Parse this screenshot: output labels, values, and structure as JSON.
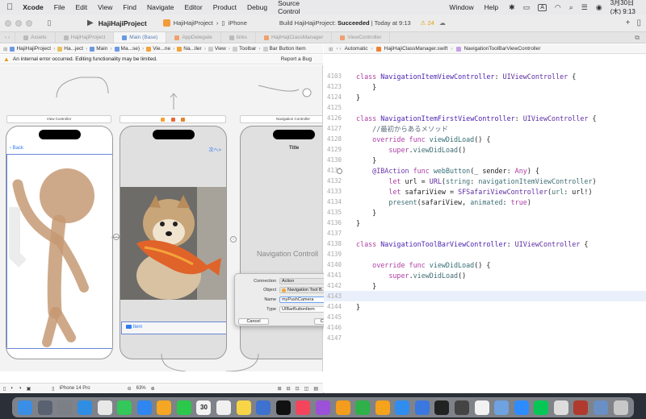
{
  "menubar": {
    "apple": "",
    "app": "Xcode",
    "items": [
      "File",
      "Edit",
      "View",
      "Find",
      "Navigate",
      "Editor",
      "Product",
      "Debug",
      "Source Control"
    ],
    "right_items": [
      "Window",
      "Help"
    ],
    "input_mode": "A",
    "datetime": "3月30日(木) 9:13"
  },
  "toolbar": {
    "project_title": "HajiHajiProject",
    "scheme": "HajiHajiProject",
    "device": "iPhone",
    "status_prefix": "Build HajiHajiProject:",
    "status_result": "Succeeded",
    "status_time": "Today at 9:13",
    "warning_count": "24"
  },
  "tabs": [
    {
      "label": "Assets"
    },
    {
      "label": "HajiHajiProject"
    },
    {
      "label": "Main (Base)"
    },
    {
      "label": "AppDelegate"
    },
    {
      "label": "links"
    },
    {
      "label": "HajiHajiClassManager"
    },
    {
      "label": "ViewController"
    }
  ],
  "jump_left": [
    "HajiHajiProject",
    "Ha...ject",
    "Main",
    "Ma...se)",
    "Vie...ne",
    "Na...ller",
    "View",
    "Toolbar",
    "Bar Button Item"
  ],
  "jump_right": [
    "Automatic",
    "HajiHajiClassManager.swift",
    "NavigationToolBarViewController"
  ],
  "banner": {
    "message": "An internal error occurred. Editing functionality may be limited.",
    "report": "Report a Bug"
  },
  "storyboard": {
    "scene1_title": "View Controller",
    "scene3_title": "Navigation Controller",
    "back_label": "Back",
    "next_label": "次へ>",
    "title_label": "Title",
    "item_label": "Item",
    "nav_controller_label": "Navigation Controll"
  },
  "popup": {
    "connection_label": "Connection",
    "connection_value": "Action",
    "object_label": "Object",
    "object_value": "Navigation Tool B...",
    "name_label": "Name",
    "name_value": "myPushCamera",
    "type_label": "Type",
    "type_value": "UIBarButtonItem",
    "cancel": "Cancel",
    "connect": "Connect"
  },
  "canvas_bottom": {
    "device": "iPhone 14 Pro",
    "zoom": "63%"
  },
  "code": {
    "lines": [
      {
        "n": "4103",
        "tokens": [
          [
            "k",
            "class "
          ],
          [
            "tb",
            "NavigationItemViewController"
          ],
          [
            "p",
            ": "
          ],
          [
            "t",
            "UIViewController"
          ],
          [
            "p",
            " {"
          ]
        ]
      },
      {
        "n": "4123",
        "tokens": [
          [
            "p",
            "    }"
          ]
        ]
      },
      {
        "n": "4124",
        "tokens": [
          [
            "p",
            "}"
          ]
        ]
      },
      {
        "n": "4125",
        "tokens": []
      },
      {
        "n": "4126",
        "tokens": [
          [
            "k",
            "class "
          ],
          [
            "tb",
            "NavigationItemFirstViewController"
          ],
          [
            "p",
            ": "
          ],
          [
            "t",
            "UIViewController"
          ],
          [
            "p",
            " {"
          ]
        ]
      },
      {
        "n": "4127",
        "tokens": [
          [
            "c",
            "    //最初からあるメソッド"
          ]
        ]
      },
      {
        "n": "4128",
        "tokens": [
          [
            "k",
            "    override func "
          ],
          [
            "f",
            "viewDidLoad"
          ],
          [
            "p",
            "() {"
          ]
        ]
      },
      {
        "n": "4129",
        "tokens": [
          [
            "k",
            "        super"
          ],
          [
            "p",
            "."
          ],
          [
            "m",
            "viewDidLoad"
          ],
          [
            "p",
            "()"
          ]
        ]
      },
      {
        "n": "4130",
        "tokens": [
          [
            "p",
            "    }"
          ]
        ]
      },
      {
        "n": "4131",
        "tokens": [
          [
            "a",
            "    @IBAction "
          ],
          [
            "k",
            "func "
          ],
          [
            "f",
            "webButton"
          ],
          [
            "p",
            "(_ sender: "
          ],
          [
            "k",
            "Any"
          ],
          [
            "p",
            ") {"
          ]
        ],
        "bp": true
      },
      {
        "n": "4132",
        "tokens": [
          [
            "k",
            "        let "
          ],
          [
            "p",
            "url = "
          ],
          [
            "t",
            "URL"
          ],
          [
            "p",
            "("
          ],
          [
            "m",
            "string"
          ],
          [
            "p",
            ": "
          ],
          [
            "m",
            "navigationItemViewController"
          ],
          [
            "p",
            ")"
          ]
        ]
      },
      {
        "n": "4133",
        "tokens": [
          [
            "k",
            "        let "
          ],
          [
            "p",
            "safariView = "
          ],
          [
            "t",
            "SFSafariViewController"
          ],
          [
            "p",
            "("
          ],
          [
            "m",
            "url"
          ],
          [
            "p",
            ": url!)"
          ]
        ]
      },
      {
        "n": "4134",
        "tokens": [
          [
            "m",
            "        present"
          ],
          [
            "p",
            "(safariView, "
          ],
          [
            "m",
            "animated"
          ],
          [
            "p",
            ": "
          ],
          [
            "k",
            "true"
          ],
          [
            "p",
            ")"
          ]
        ]
      },
      {
        "n": "4135",
        "tokens": [
          [
            "p",
            "    }"
          ]
        ]
      },
      {
        "n": "4136",
        "tokens": [
          [
            "p",
            "}"
          ]
        ]
      },
      {
        "n": "4137",
        "tokens": []
      },
      {
        "n": "4138",
        "tokens": [
          [
            "k",
            "class "
          ],
          [
            "tb",
            "NavigationToolBarViewController"
          ],
          [
            "p",
            ": "
          ],
          [
            "t",
            "UIViewController"
          ],
          [
            "p",
            " {"
          ]
        ]
      },
      {
        "n": "4139",
        "tokens": []
      },
      {
        "n": "4140",
        "tokens": [
          [
            "k",
            "    override func "
          ],
          [
            "f",
            "viewDidLoad"
          ],
          [
            "p",
            "() {"
          ]
        ]
      },
      {
        "n": "4141",
        "tokens": [
          [
            "k",
            "        super"
          ],
          [
            "p",
            "."
          ],
          [
            "m",
            "viewDidLoad"
          ],
          [
            "p",
            "()"
          ]
        ]
      },
      {
        "n": "4142",
        "tokens": [
          [
            "p",
            "    }"
          ]
        ]
      },
      {
        "n": "4143",
        "tokens": [],
        "hl": true
      },
      {
        "n": "4144",
        "tokens": [
          [
            "p",
            "}"
          ]
        ]
      },
      {
        "n": "4145",
        "tokens": []
      },
      {
        "n": "4146",
        "tokens": []
      },
      {
        "n": "4147",
        "tokens": []
      }
    ]
  },
  "dock": {
    "apps": [
      {
        "name": "finder-app",
        "color": "#3a8ee6"
      },
      {
        "name": "launchpad-app",
        "color": "#5a6170"
      },
      {
        "name": "settings-app",
        "color": "#7c7f86"
      },
      {
        "name": "safari-app",
        "color": "#2f8de4"
      },
      {
        "name": "chrome-app",
        "color": "#e8e8e8"
      },
      {
        "name": "messages-app",
        "color": "#34c759"
      },
      {
        "name": "mail-app",
        "color": "#2f86f0"
      },
      {
        "name": "photos-app",
        "color": "#f5a623"
      },
      {
        "name": "facetime-app",
        "color": "#2cc84b"
      },
      {
        "name": "calendar-app",
        "color": "#f3f3f3"
      },
      {
        "name": "reminders-app",
        "color": "#f0f0f0"
      },
      {
        "name": "notes-app",
        "color": "#f8d547"
      },
      {
        "name": "keynote-app",
        "color": "#3e71d0"
      },
      {
        "name": "appletv-app",
        "color": "#111111"
      },
      {
        "name": "music-app",
        "color": "#f5455c"
      },
      {
        "name": "podcasts-app",
        "color": "#9b51d8"
      },
      {
        "name": "books-app",
        "color": "#f39c1d"
      },
      {
        "name": "numbers-app",
        "color": "#2eb148"
      },
      {
        "name": "pages-app",
        "color": "#f5a21c"
      },
      {
        "name": "appstore-app",
        "color": "#2f8df0"
      },
      {
        "name": "xcode-app",
        "color": "#3a78e0"
      },
      {
        "name": "terminal-app",
        "color": "#222222"
      },
      {
        "name": "activity-app",
        "color": "#444444"
      },
      {
        "name": "textedit-app",
        "color": "#f2f2f2"
      },
      {
        "name": "preview-app",
        "color": "#6fa2e0"
      },
      {
        "name": "zoom-app",
        "color": "#2d8cff"
      },
      {
        "name": "line-app",
        "color": "#06c755"
      },
      {
        "name": "script-app",
        "color": "#dddddd"
      },
      {
        "name": "dictionary-app",
        "color": "#b03a2e"
      },
      {
        "name": "downloads-app",
        "color": "#6a8fc4"
      },
      {
        "name": "trash-app",
        "color": "#c8c8c8"
      }
    ],
    "calendar_day": "30"
  }
}
